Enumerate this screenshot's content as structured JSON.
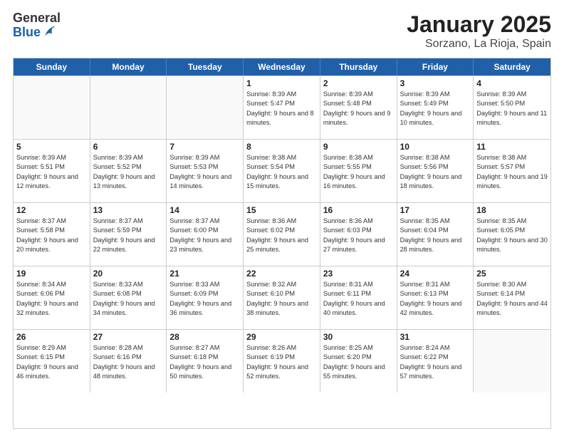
{
  "logo": {
    "general": "General",
    "blue": "Blue"
  },
  "title": "January 2025",
  "subtitle": "Sorzano, La Rioja, Spain",
  "weekdays": [
    "Sunday",
    "Monday",
    "Tuesday",
    "Wednesday",
    "Thursday",
    "Friday",
    "Saturday"
  ],
  "weeks": [
    [
      {
        "day": "",
        "info": ""
      },
      {
        "day": "",
        "info": ""
      },
      {
        "day": "",
        "info": ""
      },
      {
        "day": "1",
        "info": "Sunrise: 8:39 AM\nSunset: 5:47 PM\nDaylight: 9 hours\nand 8 minutes."
      },
      {
        "day": "2",
        "info": "Sunrise: 8:39 AM\nSunset: 5:48 PM\nDaylight: 9 hours\nand 9 minutes."
      },
      {
        "day": "3",
        "info": "Sunrise: 8:39 AM\nSunset: 5:49 PM\nDaylight: 9 hours\nand 10 minutes."
      },
      {
        "day": "4",
        "info": "Sunrise: 8:39 AM\nSunset: 5:50 PM\nDaylight: 9 hours\nand 11 minutes."
      }
    ],
    [
      {
        "day": "5",
        "info": "Sunrise: 8:39 AM\nSunset: 5:51 PM\nDaylight: 9 hours\nand 12 minutes."
      },
      {
        "day": "6",
        "info": "Sunrise: 8:39 AM\nSunset: 5:52 PM\nDaylight: 9 hours\nand 13 minutes."
      },
      {
        "day": "7",
        "info": "Sunrise: 8:39 AM\nSunset: 5:53 PM\nDaylight: 9 hours\nand 14 minutes."
      },
      {
        "day": "8",
        "info": "Sunrise: 8:38 AM\nSunset: 5:54 PM\nDaylight: 9 hours\nand 15 minutes."
      },
      {
        "day": "9",
        "info": "Sunrise: 8:38 AM\nSunset: 5:55 PM\nDaylight: 9 hours\nand 16 minutes."
      },
      {
        "day": "10",
        "info": "Sunrise: 8:38 AM\nSunset: 5:56 PM\nDaylight: 9 hours\nand 18 minutes."
      },
      {
        "day": "11",
        "info": "Sunrise: 8:38 AM\nSunset: 5:57 PM\nDaylight: 9 hours\nand 19 minutes."
      }
    ],
    [
      {
        "day": "12",
        "info": "Sunrise: 8:37 AM\nSunset: 5:58 PM\nDaylight: 9 hours\nand 20 minutes."
      },
      {
        "day": "13",
        "info": "Sunrise: 8:37 AM\nSunset: 5:59 PM\nDaylight: 9 hours\nand 22 minutes."
      },
      {
        "day": "14",
        "info": "Sunrise: 8:37 AM\nSunset: 6:00 PM\nDaylight: 9 hours\nand 23 minutes."
      },
      {
        "day": "15",
        "info": "Sunrise: 8:36 AM\nSunset: 6:02 PM\nDaylight: 9 hours\nand 25 minutes."
      },
      {
        "day": "16",
        "info": "Sunrise: 8:36 AM\nSunset: 6:03 PM\nDaylight: 9 hours\nand 27 minutes."
      },
      {
        "day": "17",
        "info": "Sunrise: 8:35 AM\nSunset: 6:04 PM\nDaylight: 9 hours\nand 28 minutes."
      },
      {
        "day": "18",
        "info": "Sunrise: 8:35 AM\nSunset: 6:05 PM\nDaylight: 9 hours\nand 30 minutes."
      }
    ],
    [
      {
        "day": "19",
        "info": "Sunrise: 8:34 AM\nSunset: 6:06 PM\nDaylight: 9 hours\nand 32 minutes."
      },
      {
        "day": "20",
        "info": "Sunrise: 8:33 AM\nSunset: 6:08 PM\nDaylight: 9 hours\nand 34 minutes."
      },
      {
        "day": "21",
        "info": "Sunrise: 8:33 AM\nSunset: 6:09 PM\nDaylight: 9 hours\nand 36 minutes."
      },
      {
        "day": "22",
        "info": "Sunrise: 8:32 AM\nSunset: 6:10 PM\nDaylight: 9 hours\nand 38 minutes."
      },
      {
        "day": "23",
        "info": "Sunrise: 8:31 AM\nSunset: 6:11 PM\nDaylight: 9 hours\nand 40 minutes."
      },
      {
        "day": "24",
        "info": "Sunrise: 8:31 AM\nSunset: 6:13 PM\nDaylight: 9 hours\nand 42 minutes."
      },
      {
        "day": "25",
        "info": "Sunrise: 8:30 AM\nSunset: 6:14 PM\nDaylight: 9 hours\nand 44 minutes."
      }
    ],
    [
      {
        "day": "26",
        "info": "Sunrise: 8:29 AM\nSunset: 6:15 PM\nDaylight: 9 hours\nand 46 minutes."
      },
      {
        "day": "27",
        "info": "Sunrise: 8:28 AM\nSunset: 6:16 PM\nDaylight: 9 hours\nand 48 minutes."
      },
      {
        "day": "28",
        "info": "Sunrise: 8:27 AM\nSunset: 6:18 PM\nDaylight: 9 hours\nand 50 minutes."
      },
      {
        "day": "29",
        "info": "Sunrise: 8:26 AM\nSunset: 6:19 PM\nDaylight: 9 hours\nand 52 minutes."
      },
      {
        "day": "30",
        "info": "Sunrise: 8:25 AM\nSunset: 6:20 PM\nDaylight: 9 hours\nand 55 minutes."
      },
      {
        "day": "31",
        "info": "Sunrise: 8:24 AM\nSunset: 6:22 PM\nDaylight: 9 hours\nand 57 minutes."
      },
      {
        "day": "",
        "info": ""
      }
    ]
  ]
}
